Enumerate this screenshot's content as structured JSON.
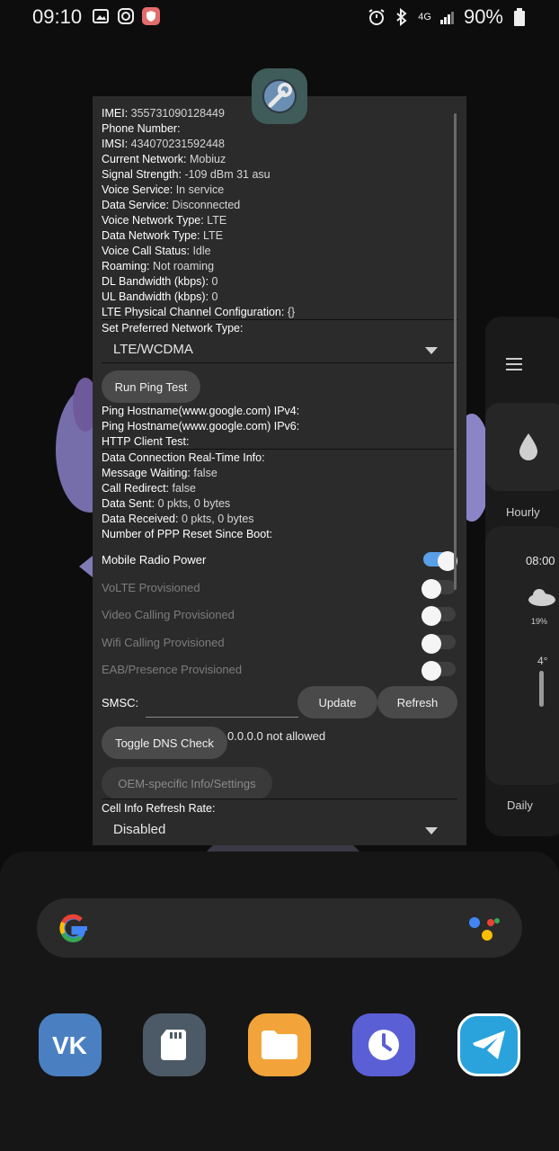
{
  "status_bar": {
    "time": "09:10",
    "network": "4G",
    "battery": "90%"
  },
  "dialog": {
    "info": [
      {
        "label": "IMEI:",
        "value": "355731090128449"
      },
      {
        "label": "Phone Number:",
        "value": ""
      },
      {
        "label": "IMSI:",
        "value": "434070231592448"
      },
      {
        "label": "Current Network:",
        "value": "Mobiuz"
      },
      {
        "label": "Signal Strength:",
        "value": "-109 dBm   31 asu"
      },
      {
        "label": "Voice Service:",
        "value": "In service"
      },
      {
        "label": "Data Service:",
        "value": "Disconnected"
      },
      {
        "label": "Voice Network Type:",
        "value": "LTE"
      },
      {
        "label": "Data Network Type:",
        "value": "LTE"
      },
      {
        "label": "Voice Call Status:",
        "value": "Idle"
      },
      {
        "label": "Roaming:",
        "value": "Not roaming"
      },
      {
        "label": "DL Bandwidth (kbps):",
        "value": "0"
      },
      {
        "label": "UL Bandwidth (kbps):",
        "value": "0"
      },
      {
        "label": "LTE Physical Channel Configuration:",
        "value": "{}"
      }
    ],
    "preferred_network_label": "Set Preferred Network Type:",
    "preferred_network_value": "LTE/WCDMA",
    "ping_button": "Run Ping Test",
    "ping_lines": [
      {
        "label": "Ping Hostname(www.google.com) IPv4:",
        "value": ""
      },
      {
        "label": "Ping Hostname(www.google.com) IPv6:",
        "value": ""
      },
      {
        "label": "HTTP Client Test:",
        "value": ""
      }
    ],
    "data_lines": [
      {
        "label": "Data Connection Real-Time Info:",
        "value": ""
      },
      {
        "label": "Message Waiting:",
        "value": "false"
      },
      {
        "label": "Call Redirect:",
        "value": "false"
      },
      {
        "label": "Data Sent:",
        "value": "0 pkts, 0 bytes"
      },
      {
        "label": "Data Received:",
        "value": "0 pkts, 0 bytes"
      },
      {
        "label": "Number of PPP Reset Since Boot:",
        "value": ""
      }
    ],
    "switches": [
      {
        "label": "Mobile Radio Power",
        "on": true,
        "enabled": true
      },
      {
        "label": "VoLTE Provisioned",
        "on": false,
        "enabled": false
      },
      {
        "label": "Video Calling Provisioned",
        "on": false,
        "enabled": false
      },
      {
        "label": "Wifi Calling Provisioned",
        "on": false,
        "enabled": false
      },
      {
        "label": "EAB/Presence Provisioned",
        "on": false,
        "enabled": false
      }
    ],
    "smsc_label": "SMSC:",
    "smsc_value": "",
    "update_button": "Update",
    "refresh_button": "Refresh",
    "dns_button": "Toggle DNS Check",
    "dns_status": "0.0.0.0 not allowed",
    "oem_button": "OEM-specific Info/Settings",
    "cell_refresh_label": "Cell Info Refresh Rate:",
    "cell_refresh_value": "Disabled"
  },
  "weather": {
    "hourly_label": "Hourly",
    "time": "08:00",
    "precip": "19%",
    "temp": "4°",
    "daily_label": "Daily"
  },
  "dock": {
    "apps": [
      "vk-app",
      "sd-card-app",
      "files-app",
      "clock-app",
      "telegram-app"
    ]
  },
  "colors": {
    "dialog_bg": "#2b2b2b",
    "switch_on": "#5aa0e8",
    "vk": "#4a80c2",
    "telegram": "#2aa3dc",
    "files": "#f2a43a",
    "clock": "#5b5fd6"
  }
}
